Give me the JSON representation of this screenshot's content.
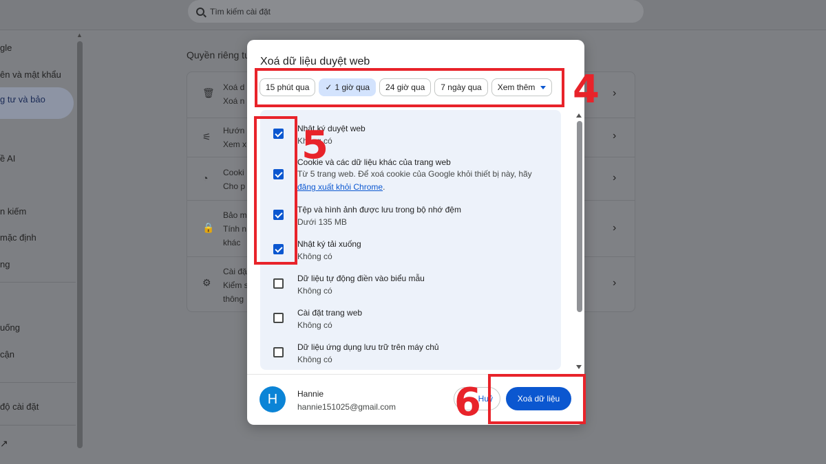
{
  "background": {
    "search_placeholder": "Tìm kiếm cài đặt",
    "sidebar_items": [
      "gle",
      "ên và mật khẩu",
      "g tư và bảo",
      "ề AI",
      "n kiếm",
      "mặc định",
      "ng",
      "uống",
      "cận",
      "độ cài đặt"
    ],
    "section_title": "Quyền riêng tư",
    "card_rows": [
      {
        "line1": "Xoá d",
        "line2": "Xoá n"
      },
      {
        "line1": "Hướn",
        "line2": "Xem x"
      },
      {
        "line1": "Cooki",
        "line2": "Cho p"
      },
      {
        "line1": "Bảo m",
        "line2": "Tính n",
        "line3": "khác"
      },
      {
        "line1": "Cài đặ",
        "line2": "Kiểm s",
        "line3": "thông"
      }
    ]
  },
  "dialog": {
    "title": "Xoá dữ liệu duyệt web",
    "time_ranges": [
      {
        "label": "15 phút qua",
        "selected": false
      },
      {
        "label": "1 giờ qua",
        "selected": true
      },
      {
        "label": "24 giờ qua",
        "selected": false
      },
      {
        "label": "7 ngày qua",
        "selected": false
      }
    ],
    "more_label": "Xem thêm",
    "items": [
      {
        "title": "Nhật ký duyệt web",
        "sub": "Không có",
        "checked": true
      },
      {
        "title": "Cookie và các dữ liệu khác của trang web",
        "sub": "Từ 5 trang web. Để xoá cookie của Google khỏi thiết bị này, hãy ",
        "link": "đăng xuất khỏi Chrome",
        "sub_end": ".",
        "checked": true
      },
      {
        "title": "Tệp và hình ảnh được lưu trong bộ nhớ đệm",
        "sub": "Dưới 135 MB",
        "checked": true
      },
      {
        "title": "Nhật ký tải xuống",
        "sub": "Không có",
        "checked": true
      },
      {
        "title": "Dữ liệu tự động điền vào biểu mẫu",
        "sub": "Không có",
        "checked": false
      },
      {
        "title": "Cài đặt trang web",
        "sub": "Không có",
        "checked": false
      },
      {
        "title": "Dữ liệu ứng dụng lưu trữ trên máy chủ",
        "sub": "Không có",
        "checked": false
      }
    ],
    "user": {
      "initial": "H",
      "name": "Hannie",
      "email": "hannie151025@gmail.com"
    },
    "cancel_label": "Huỷ",
    "clear_label": "Xoá dữ liệu"
  },
  "annotations": {
    "n4": "4",
    "n5": "5",
    "n6": "6",
    "color": "#e8232a"
  }
}
